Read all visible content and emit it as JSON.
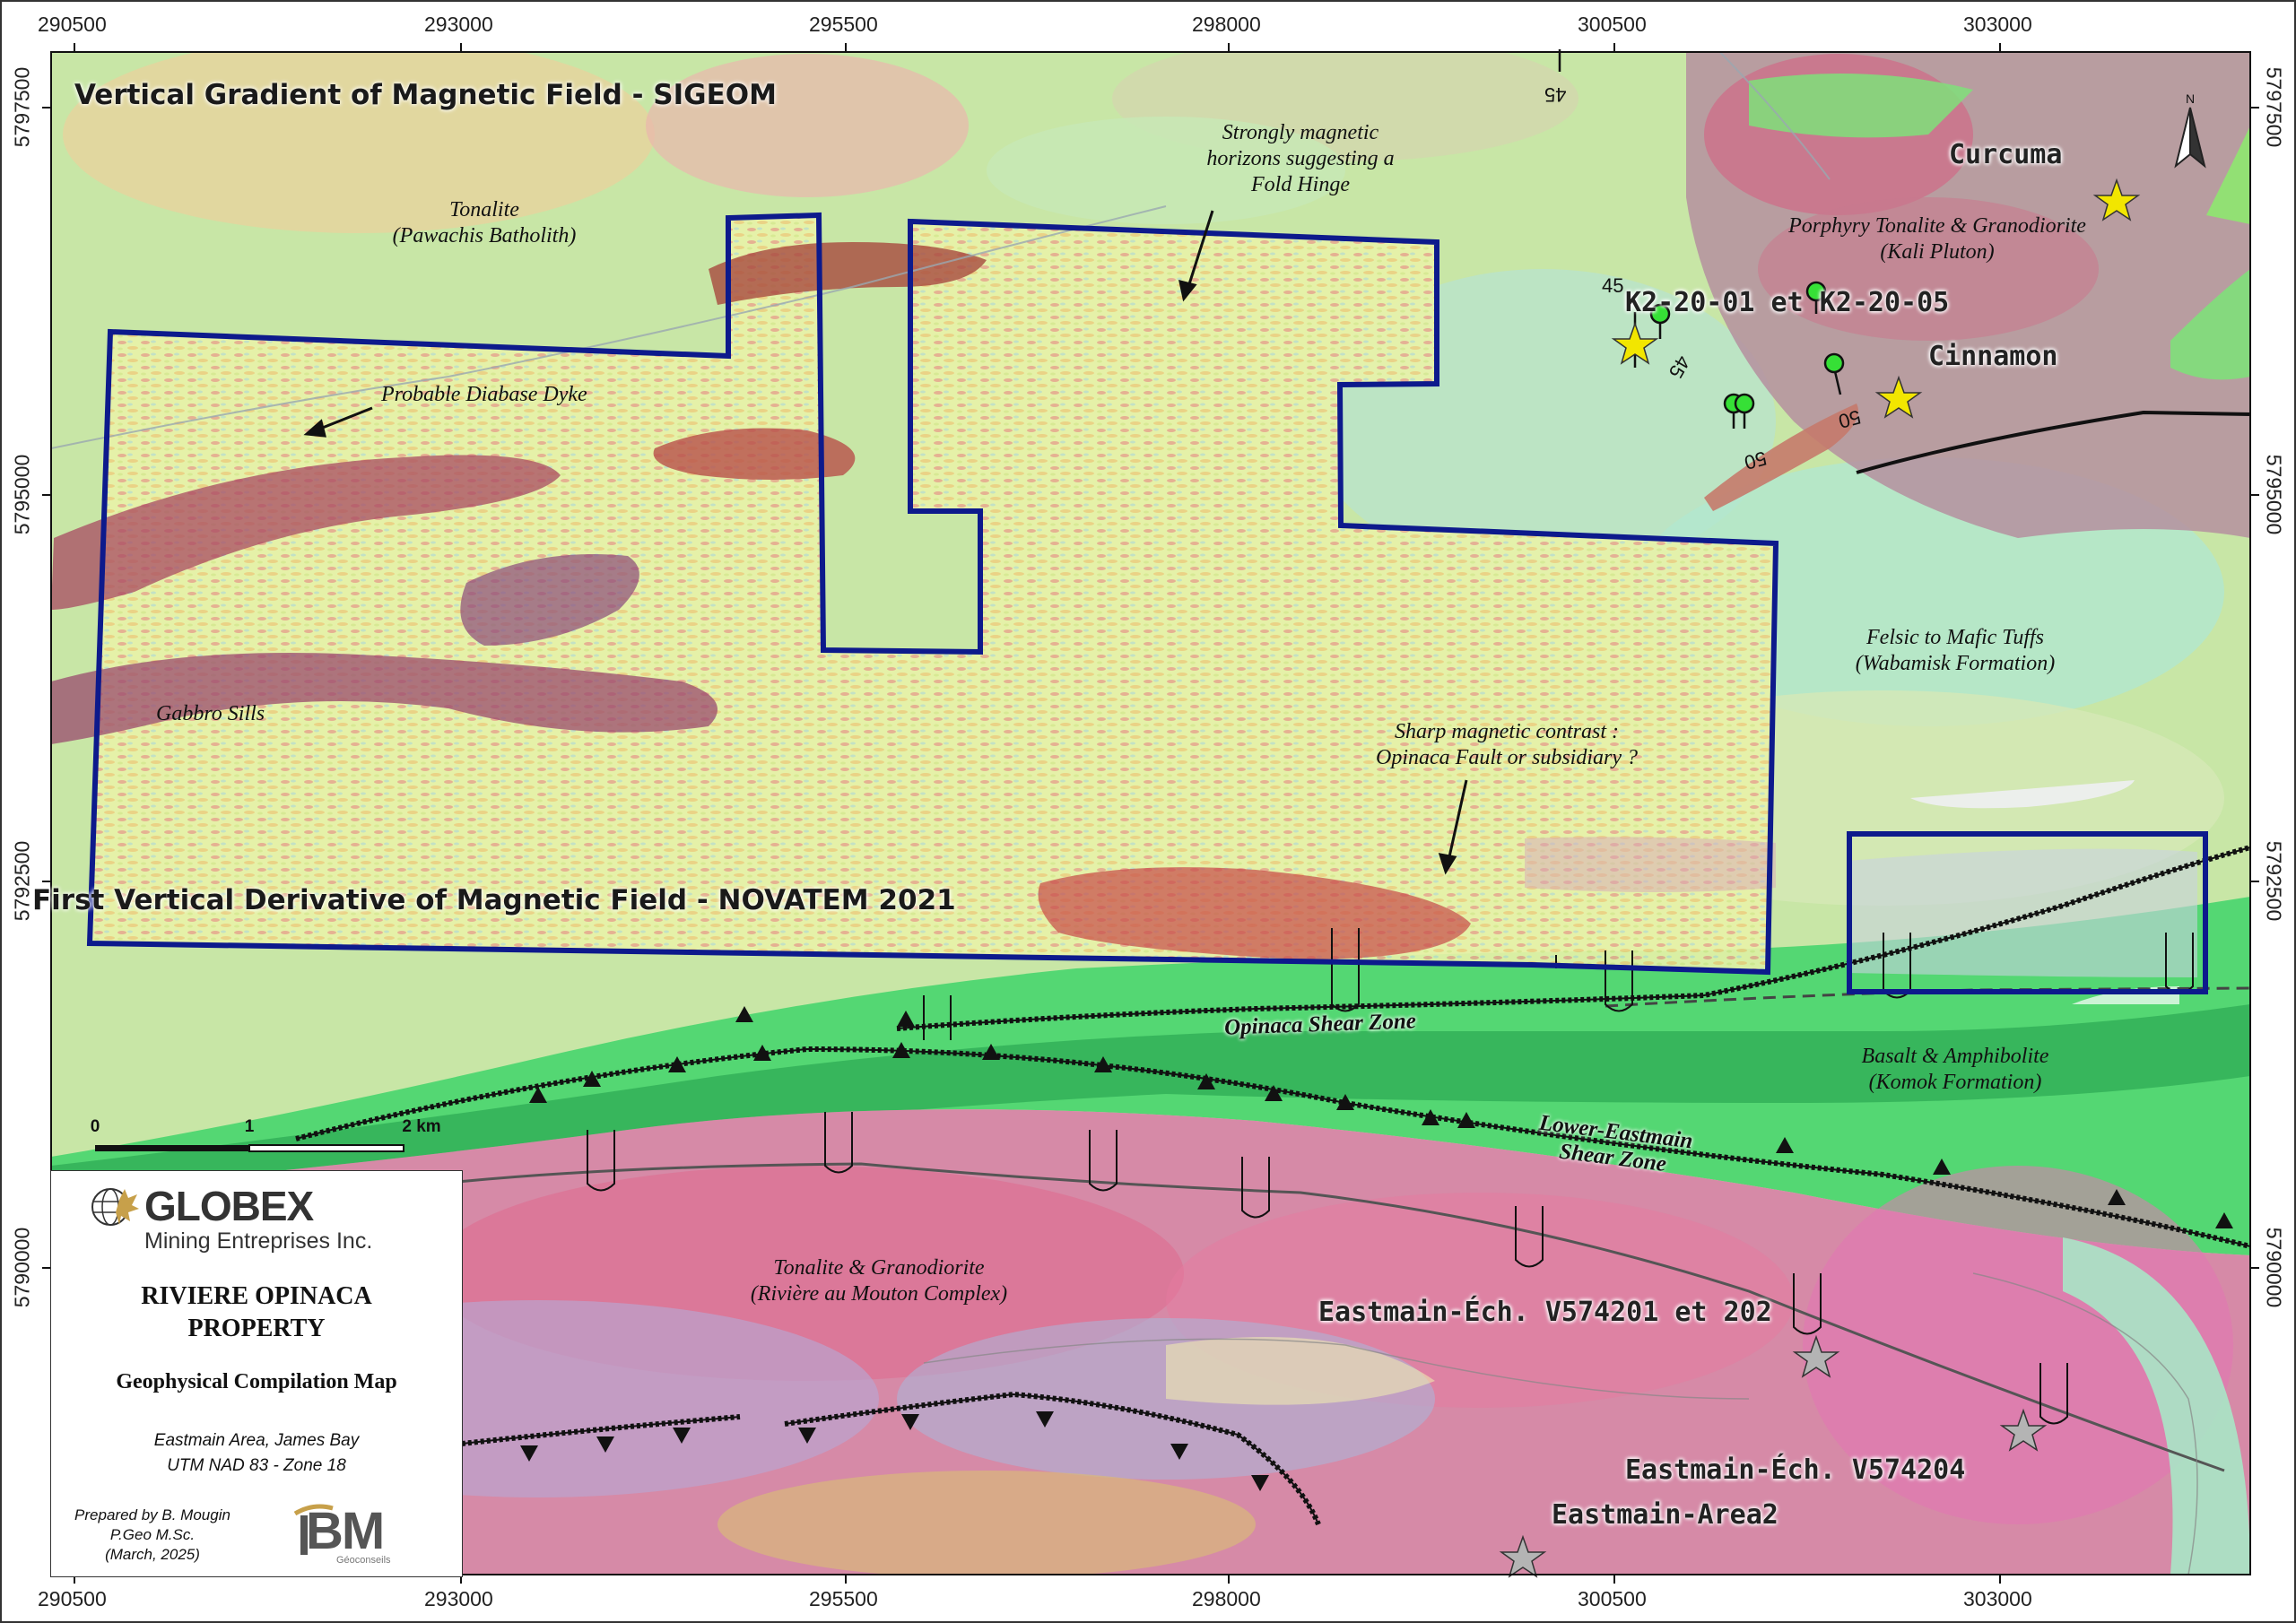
{
  "map": {
    "titles": {
      "top": "Vertical Gradient of Magnetic Field - SIGEOM",
      "middle": "First Vertical Derivative of Magnetic Field - NOVATEM 2021"
    },
    "grid": {
      "x_labels": [
        "290500",
        "293000",
        "295500",
        "298000",
        "300500",
        "303000"
      ],
      "y_labels": [
        "5797500",
        "5795000",
        "5792500",
        "5790000"
      ]
    },
    "units": [
      {
        "name": "Tonalite",
        "sub": "(Pawachis Batholith)"
      },
      {
        "name": "Porphyry Tonalite & Granodiorite",
        "sub": "(Kali Pluton)"
      },
      {
        "name": "Felsic to Mafic Tuffs",
        "sub": "(Wabamisk Formation)"
      },
      {
        "name": "Basalt & Amphibolite",
        "sub": "(Komok Formation)"
      },
      {
        "name": "Tonalite & Granodiorite",
        "sub": "(Rivière au Mouton Complex)"
      }
    ],
    "annotations": {
      "dyke": "Probable Diabase Dyke",
      "sills": "Gabbro Sills",
      "fold_line1": "Strongly magnetic",
      "fold_line2": "horizons suggesting a",
      "fold_line3": "Fold Hinge",
      "contrast_line1": "Sharp magnetic contrast :",
      "contrast_line2": "Opinaca Fault or subsidiary ?"
    },
    "structures": {
      "opinaca": "Opinaca Shear Zone",
      "lower_line1": "Lower-Eastmain",
      "lower_line2": "Shear Zone"
    },
    "occurrences": {
      "curcuma": "Curcuma",
      "cinnamon": "Cinnamon",
      "k2": "K2-20-01 et K2-20-05",
      "ech1": "Eastmain-Éch. V574201 et 202",
      "ech2": "Eastmain-Éch. V574204",
      "area2": "Eastmain-Area2"
    },
    "dips": [
      "45",
      "45",
      "45",
      "50",
      "50"
    ],
    "scale": {
      "t0": "0",
      "t1": "1",
      "t2": "2 km"
    },
    "north": "N",
    "colors": {
      "property_outline": "#0d1a8c",
      "star_gold": "#f2e600",
      "star_grey": "#b4b4b4",
      "drill": "#36e036"
    }
  },
  "legend": {
    "company": "GLOBEX",
    "company_sub": "Mining Entreprises Inc.",
    "property_line1": "RIVIERE OPINACA",
    "property_line2": "PROPERTY",
    "map_title": "Geophysical Compilation Map",
    "area": "Eastmain Area, James Bay",
    "projection": "UTM NAD 83 - Zone 18",
    "prepared_line1": "Prepared by B. Mougin",
    "prepared_line2": "P.Geo M.Sc.",
    "prepared_line3": "(March, 2025)",
    "logo2_text": "BM",
    "logo2_sub": "Géoconseils"
  }
}
